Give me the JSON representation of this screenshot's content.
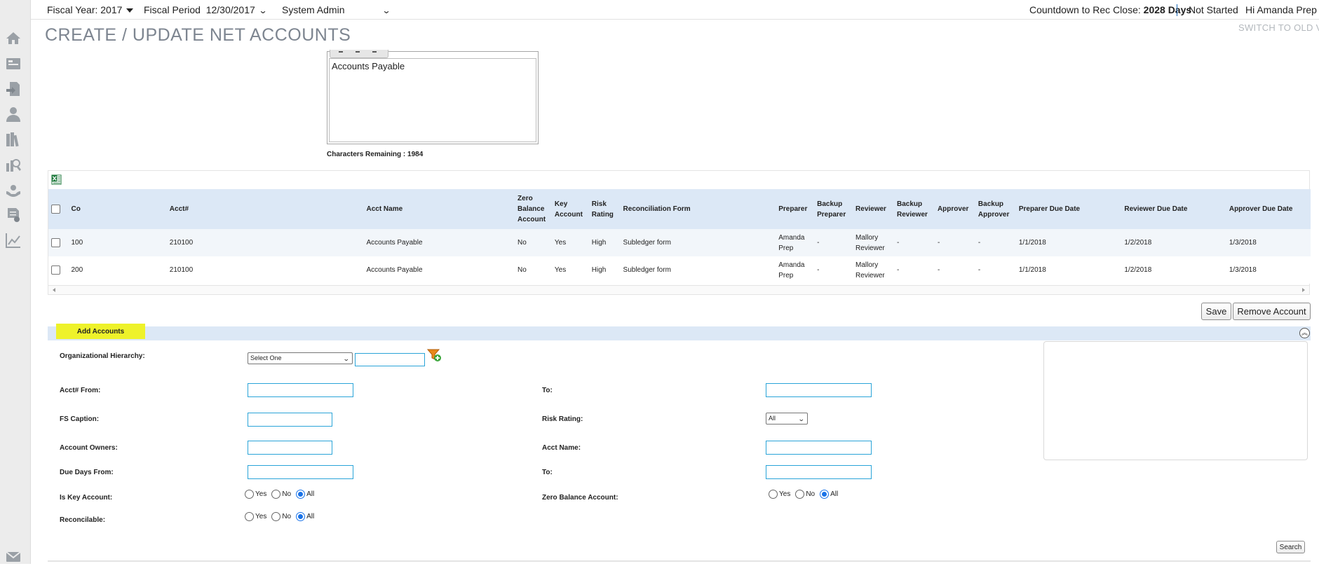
{
  "topbar": {
    "fiscal_year": "Fiscal Year: 2017",
    "fiscal_period_label": "Fiscal Period",
    "fiscal_period_value": "12/30/2017",
    "role": "System Admin",
    "countdown_label": "Countdown to Rec Close:",
    "countdown_value": "2028 Days",
    "status": "Not Started",
    "greeting": "Hi Amanda Prep"
  },
  "page": {
    "title": "CREATE / UPDATE NET ACCOUNTS",
    "switch_link": "SWITCH TO OLD VI"
  },
  "sidebar": {
    "icons": [
      "home-icon",
      "dashboard-icon",
      "import-icon",
      "user-icon",
      "library-icon",
      "search-report-icon",
      "gear-hand-icon",
      "certificate-icon",
      "chart-icon",
      "mail-icon"
    ]
  },
  "editor": {
    "text": "Accounts Payable",
    "chars_remaining": "Characters Remaining : 1984"
  },
  "grid": {
    "columns": [
      "Co",
      "Acct#",
      "Acct Name",
      "Zero Balance Account",
      "Key Account",
      "Risk Rating",
      "Reconciliation Form",
      "Preparer",
      "Backup Preparer",
      "Reviewer",
      "Backup Reviewer",
      "Approver",
      "Backup Approver",
      "Preparer Due Date",
      "Reviewer Due Date",
      "Approver Due Date"
    ],
    "rows": [
      {
        "co": "100",
        "acct": "210100",
        "name": "Accounts Payable",
        "zero": "No",
        "key": "Yes",
        "risk": "High",
        "form": "Subledger form",
        "preparer": "Amanda Prep",
        "backup_preparer": "-",
        "reviewer": "Mallory Reviewer",
        "backup_reviewer": "-",
        "approver": "-",
        "backup_approver": "-",
        "prep_due": "1/1/2018",
        "rev_due": "1/2/2018",
        "appr_due": "1/3/2018"
      },
      {
        "co": "200",
        "acct": "210100",
        "name": "Accounts Payable",
        "zero": "No",
        "key": "Yes",
        "risk": "High",
        "form": "Subledger form",
        "preparer": "Amanda Prep",
        "backup_preparer": "-",
        "reviewer": "Mallory Reviewer",
        "backup_reviewer": "-",
        "approver": "-",
        "backup_approver": "-",
        "prep_due": "1/1/2018",
        "rev_due": "1/2/2018",
        "appr_due": "1/3/2018"
      }
    ]
  },
  "buttons": {
    "save": "Save",
    "remove_account": "Remove Account",
    "search": "Search"
  },
  "add_accounts": {
    "header": "Add Accounts",
    "org_hierarchy_label": "Organizational Hierarchy:",
    "org_hierarchy_select": "Select One",
    "acct_from_label": "Acct# From:",
    "acct_to_label": "To:",
    "fs_caption_label": "FS Caption:",
    "risk_rating_label": "Risk Rating:",
    "risk_rating_value": "All",
    "account_owners_label": "Account Owners:",
    "acct_name_label": "Acct Name:",
    "due_days_from_label": "Due Days From:",
    "due_days_to_label": "To:",
    "is_key_account_label": "Is Key Account:",
    "zero_balance_label": "Zero Balance Account:",
    "reconcilable_label": "Reconcilable:",
    "radio_yes": "Yes",
    "radio_no": "No",
    "radio_all": "All"
  },
  "colors": {
    "header_bg": "#dce8f6",
    "highlight": "#eef22a",
    "input_border": "#2aa4d8"
  }
}
